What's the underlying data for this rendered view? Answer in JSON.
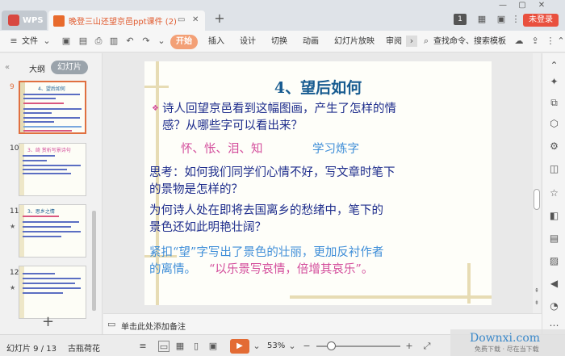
{
  "window": {
    "app_tab": "WPS",
    "doc_tab_title": "晚登三山还望京邑ppt课件 (2)",
    "login_button": "未登录",
    "page_badge": "1"
  },
  "ribbon": {
    "file_menu": "文件",
    "tabs": [
      "开始",
      "插入",
      "设计",
      "切换",
      "动画",
      "幻灯片放映",
      "审阅"
    ],
    "search_label": "查找命令、搜索模板"
  },
  "left_panel": {
    "tab_outline": "大纲",
    "tab_slides": "幻灯片",
    "thumbnails": [
      {
        "number": "9",
        "title": "4、望后如何",
        "selected": true
      },
      {
        "number": "10",
        "title": "3、绮 赏析写景诗句",
        "selected": false
      },
      {
        "number": "11",
        "title": "3、思乡之情",
        "selected": false
      },
      {
        "number": "12",
        "title": "",
        "selected": false
      }
    ]
  },
  "slide": {
    "title": "4、望后如何",
    "bullet": "❖",
    "line1": "诗人回望京邑看到这幅图画，产生了怎样的情",
    "line2": "感？从哪些字可以看出来？",
    "keywords": "怀、怅、泪、知",
    "keywords_note": "学习炼字",
    "think1": "思考：如何我们同学们心情不好，写文章时笔下",
    "think2": "的景物是怎样的？",
    "q1": "为何诗人处在即将去国离乡的愁绪中，笔下的",
    "q2": "景色还如此明艳壮阔？",
    "c1": "紧扣“望”字写出了景色的壮丽，更加反衬作者",
    "c2a": "的离情。",
    "c2b": "“以乐景写哀情，倍增其哀乐”。"
  },
  "notes": {
    "placeholder": "单击此处添加备注"
  },
  "status": {
    "slide_info": "幻灯片 9 / 13",
    "theme": "古瓶荷花",
    "zoom": "53%",
    "watermark": "Downxi.com",
    "watermark_sub": "免费下载 · 尽在当下载"
  },
  "colors": {
    "accent": "#e36b34",
    "slide_title": "#175b90",
    "slide_text": "#1e2d8c",
    "slide_pink": "#d34c9b",
    "slide_blue": "#3f8ed8"
  }
}
